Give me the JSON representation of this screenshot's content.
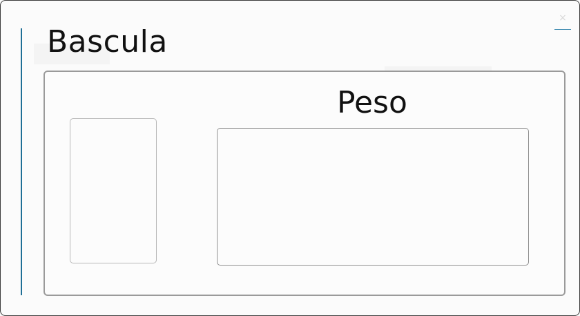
{
  "window": {
    "title": "Bascula",
    "close_glyph": "×"
  },
  "panel": {
    "weight_label": "Peso",
    "weight_value": "",
    "left_display_value": ""
  },
  "colors": {
    "accent": "#1f6f96",
    "border": "#9a9a9a",
    "text": "#111111"
  },
  "icons": {
    "close": "close-icon"
  }
}
